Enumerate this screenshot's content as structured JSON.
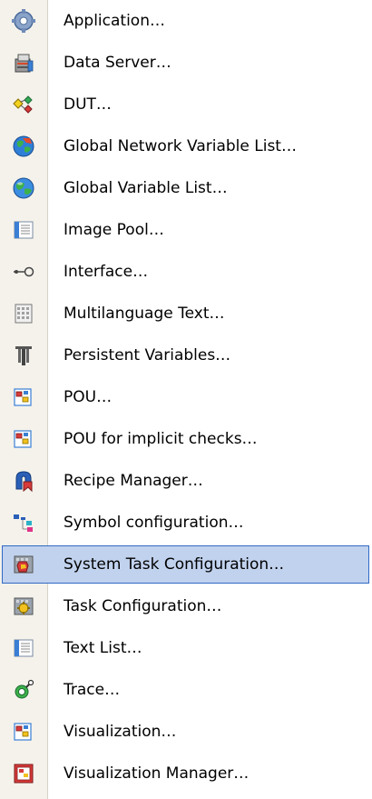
{
  "menu": {
    "highlight_color": "#c1d2ee",
    "highlight_border": "#316ac5",
    "items": [
      {
        "label": "Application…",
        "icon": "gear-icon"
      },
      {
        "label": "Data Server…",
        "icon": "data-server-icon"
      },
      {
        "label": "DUT…",
        "icon": "dut-icon"
      },
      {
        "label": "Global Network Variable List…",
        "icon": "globe-network-icon"
      },
      {
        "label": "Global Variable List…",
        "icon": "globe-icon"
      },
      {
        "label": "Image Pool…",
        "icon": "image-pool-icon"
      },
      {
        "label": "Interface…",
        "icon": "interface-icon"
      },
      {
        "label": "Multilanguage Text…",
        "icon": "multilanguage-text-icon"
      },
      {
        "label": "Persistent Variables…",
        "icon": "persistent-variables-icon"
      },
      {
        "label": "POU…",
        "icon": "pou-icon"
      },
      {
        "label": "POU for implicit checks…",
        "icon": "pou-checks-icon"
      },
      {
        "label": "Recipe Manager…",
        "icon": "recipe-manager-icon"
      },
      {
        "label": "Symbol configuration…",
        "icon": "symbol-configuration-icon"
      },
      {
        "label": "System Task Configuration…",
        "icon": "system-task-configuration-icon",
        "highlighted": true
      },
      {
        "label": "Task Configuration…",
        "icon": "task-configuration-icon"
      },
      {
        "label": "Text List…",
        "icon": "text-list-icon"
      },
      {
        "label": "Trace…",
        "icon": "trace-icon"
      },
      {
        "label": "Visualization…",
        "icon": "visualization-icon"
      },
      {
        "label": "Visualization Manager…",
        "icon": "visualization-manager-icon"
      }
    ]
  }
}
